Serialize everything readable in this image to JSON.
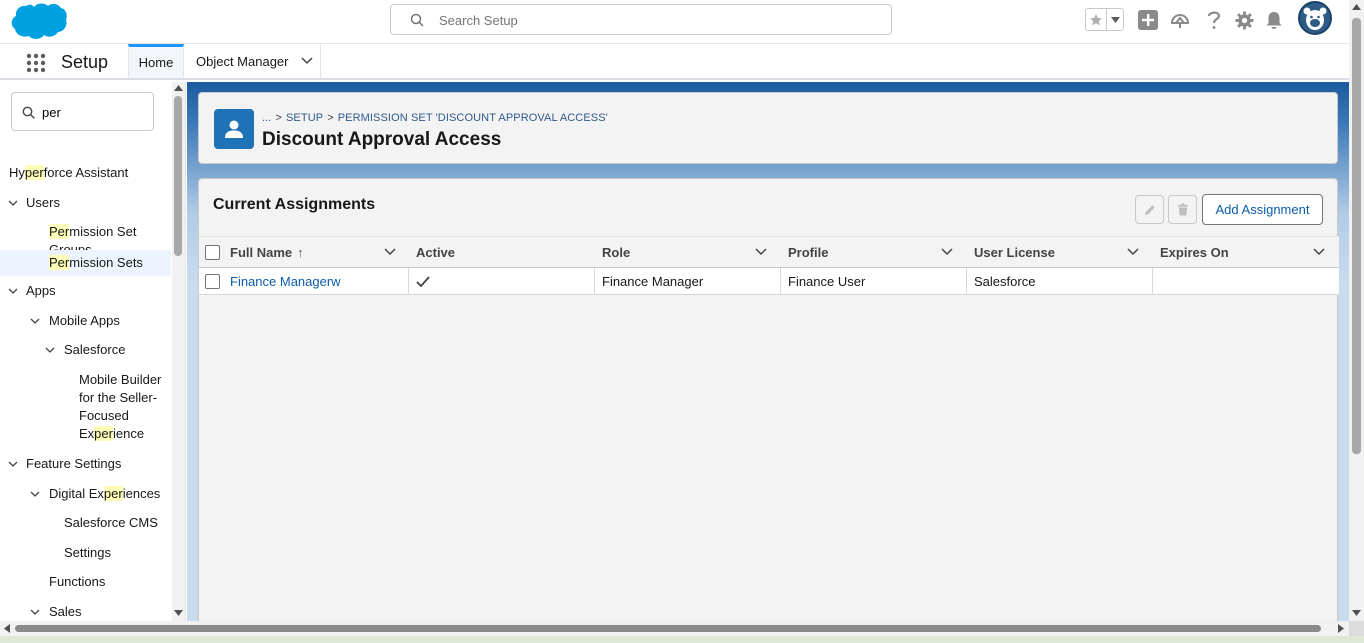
{
  "header": {
    "search_placeholder": "Search Setup",
    "icons": [
      "salesforce-cloud-logo",
      "star-icon",
      "chevron-down-icon",
      "plus-icon",
      "trailhead-icon",
      "help-icon",
      "gear-icon",
      "bell-icon",
      "avatar"
    ]
  },
  "app_nav": {
    "app_name": "Setup",
    "tabs": [
      {
        "label": "Home",
        "active": true
      },
      {
        "label": "Object Manager",
        "active": false
      }
    ]
  },
  "sidebar": {
    "quick_find_value": "per",
    "items": [
      {
        "label": "Hyperforce Assistant"
      },
      {
        "label": "Users",
        "expanded": true
      },
      {
        "label": "Permission Set Groups"
      },
      {
        "label": "Permission Sets",
        "selected": true
      },
      {
        "label": "Apps",
        "expanded": true
      },
      {
        "label": "Mobile Apps",
        "expanded": true
      },
      {
        "label": "Salesforce",
        "expanded": true
      },
      {
        "label": "Mobile Builder for the Seller-Focused Experience"
      },
      {
        "label": "Feature Settings",
        "expanded": true
      },
      {
        "label": "Digital Experiences",
        "expanded": true
      },
      {
        "label": "Salesforce CMS"
      },
      {
        "label": "Settings"
      },
      {
        "label": "Functions"
      },
      {
        "label": "Sales",
        "expanded": true
      }
    ]
  },
  "page_header": {
    "breadcrumb": [
      "...",
      "SETUP",
      "PERMISSION SET 'DISCOUNT APPROVAL ACCESS'"
    ],
    "title": "Discount Approval Access"
  },
  "card": {
    "title": "Current Assignments",
    "add_button": "Add Assignment",
    "columns": [
      "Full Name",
      "Active",
      "Role",
      "Profile",
      "User License",
      "Expires On"
    ],
    "sort_indicator": "↑",
    "rows": [
      {
        "full_name": "Finance Managerw",
        "active": true,
        "role": "Finance Manager",
        "profile": "Finance User",
        "user_license": "Salesforce",
        "expires_on": ""
      }
    ]
  },
  "colors": {
    "brand": "#00a1e0",
    "link": "#0b5cab",
    "header_band": "#1b5a9e",
    "highlight": "#fefdb7"
  }
}
